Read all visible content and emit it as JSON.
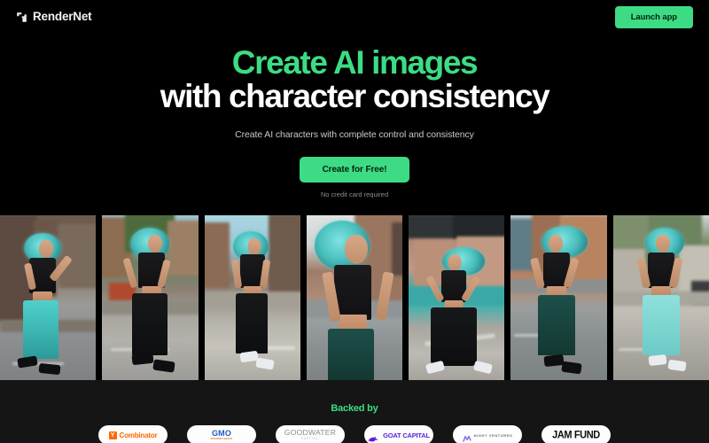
{
  "theme": {
    "page_bg": "#000000",
    "accent_green": "#3ddc84",
    "footer_bg": "#151515",
    "heading_white": "#ffffff",
    "subtext_gray": "#c9c9c9",
    "muted_gray": "#8f8f8f"
  },
  "header": {
    "brand_name": "RenderNet",
    "brand_mark_icon": "rendernet-logo-icon",
    "launch_label": "Launch app"
  },
  "hero": {
    "headline_line1": "Create AI images",
    "headline_line2": "with character consistency",
    "subtitle": "Create AI characters with complete control and consistency",
    "cta_label": "Create for Free!",
    "cta_note": "No credit card required"
  },
  "gallery": {
    "count": 7,
    "alt_subject": "AI-generated character with teal curly hair, black crop top, on urban street",
    "shots": [
      {
        "name": "shot-1",
        "bg": "bg-a",
        "pants": "p-teal",
        "shoes": "s-black",
        "pose": "walking-left-arm-up"
      },
      {
        "name": "shot-2",
        "bg": "bg-b",
        "pants": "p-black",
        "shoes": "s-black",
        "pose": "laughing-walking"
      },
      {
        "name": "shot-3",
        "bg": "bg-c",
        "pants": "p-black",
        "shoes": "s-white",
        "pose": "walking-forward"
      },
      {
        "name": "shot-4",
        "bg": "bg-d",
        "pants": "p-dgreen",
        "shoes": "s-black",
        "pose": "closeup-portrait"
      },
      {
        "name": "shot-5",
        "bg": "bg-e",
        "pants": "p-black",
        "shoes": "s-white",
        "pose": "wide-stance-dancing"
      },
      {
        "name": "shot-6",
        "bg": "bg-f",
        "pants": "p-dgreen",
        "shoes": "s-black",
        "pose": "running-toward"
      },
      {
        "name": "shot-7",
        "bg": "bg-g",
        "pants": "p-ltteal",
        "shoes": "s-white",
        "pose": "walking-smiling"
      }
    ]
  },
  "backed_by": {
    "title": "Backed by",
    "logos": [
      {
        "name": "y-combinator",
        "badge": "Y",
        "text": "Combinator",
        "color": "#ff6600"
      },
      {
        "name": "gmo",
        "text": "GMO",
        "sub": "INTERNET GROUP",
        "color": "#1f5bbf"
      },
      {
        "name": "goodwater",
        "text": "GOODWATER",
        "sub": "CAPITAL",
        "color": "#8d8d8d"
      },
      {
        "name": "goat-capital",
        "text": "GOAT CAPITAL",
        "icon": "goat-icon",
        "color": "#5b24d6"
      },
      {
        "name": "night-ventures",
        "text": "NIGHT VENTURES",
        "icon": "night-n-icon",
        "color": "#6b6b78"
      },
      {
        "name": "jam-fund",
        "text": "JAM FUND",
        "color": "#0e0e0e"
      }
    ]
  }
}
